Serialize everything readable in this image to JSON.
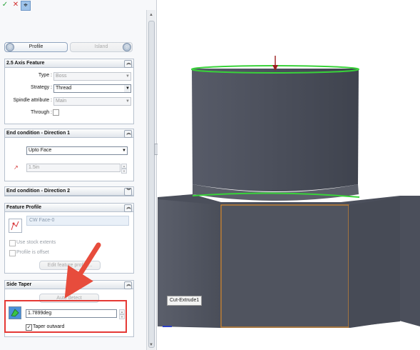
{
  "toolbar": {
    "ok_icon": "check-icon",
    "cancel_icon": "close-icon",
    "pin_icon": "pushpin-icon"
  },
  "tabs": {
    "profile": "Profile",
    "island": "Island"
  },
  "axis_feature": {
    "title": "2.5 Axis Feature",
    "type_label": "Type :",
    "type_value": "Boss",
    "strategy_label": "Strategy :",
    "strategy_value": "Thread",
    "spindle_label": "Spindle attribute :",
    "spindle_value": "Main",
    "through_label": "Through :"
  },
  "end_condition_1": {
    "title": "End condition - Direction 1",
    "value": "Upto Face",
    "depth": "1.5in"
  },
  "end_condition_2": {
    "title": "End condition - Direction 2"
  },
  "feature_profile": {
    "title": "Feature Profile",
    "list_item": "CW Face-0",
    "use_stock": "Use stock extents",
    "profile_offset": "Profile is offset",
    "edit_button": "Edit feature profile..."
  },
  "side_taper": {
    "title": "Side Taper",
    "auto_detect": "Auto detect",
    "angle": "1.7899deg",
    "taper_outward": "Taper outward",
    "taper_outward_checked": true
  },
  "viewport": {
    "tooltip": "Cut-Extrude1"
  },
  "colors": {
    "accent_red": "#e53935",
    "highlight_green": "#39d23a",
    "model_gray": "#4b4f5b",
    "edge_orange": "#d88a2c"
  }
}
